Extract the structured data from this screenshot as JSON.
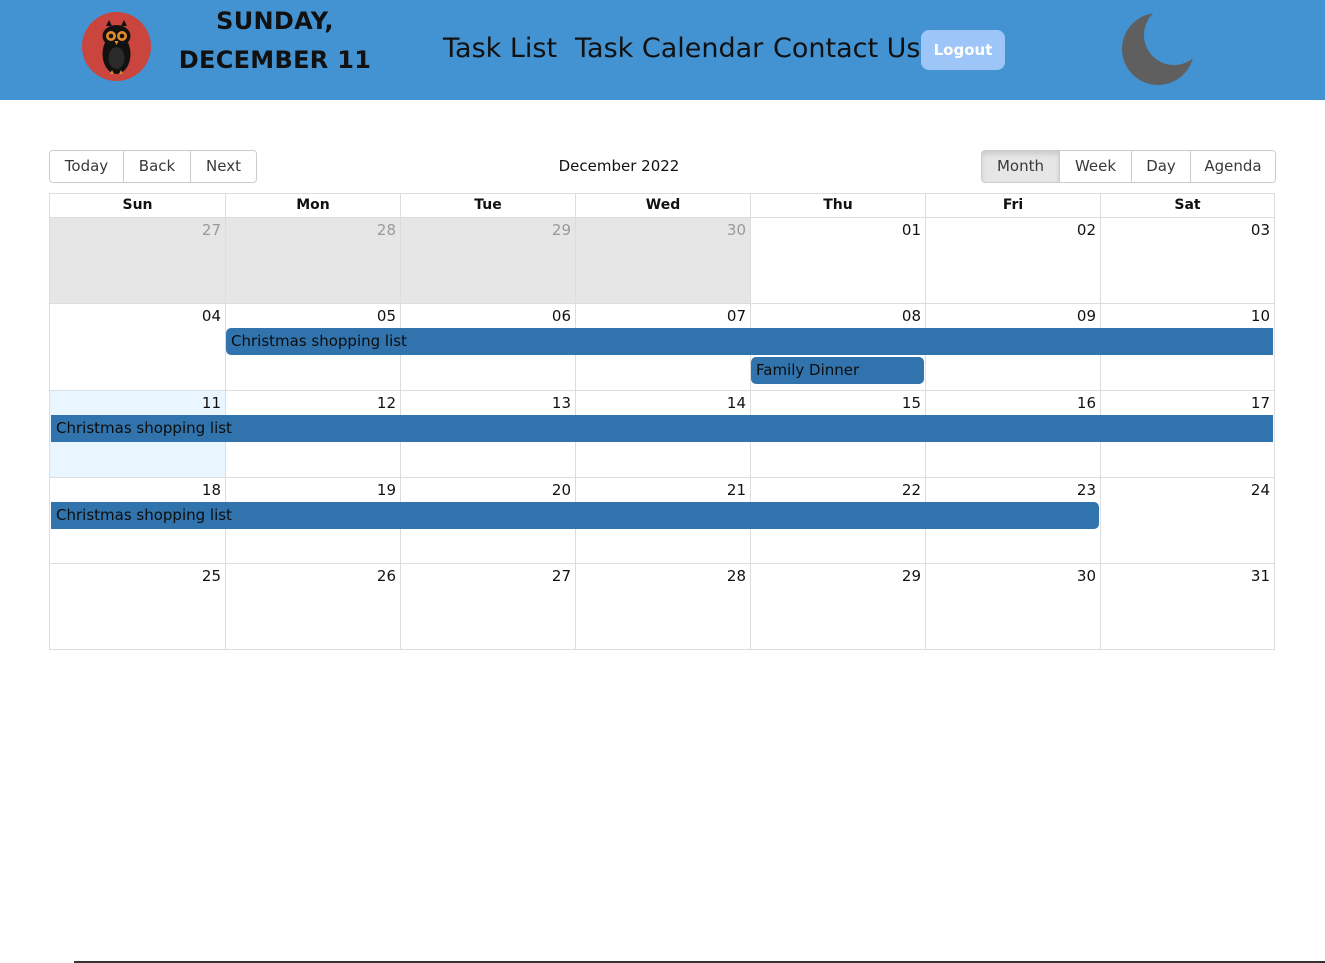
{
  "header": {
    "date_line1": "SUNDAY,",
    "date_line2": "DECEMBER 11",
    "nav": [
      "Task List",
      "Task Calendar",
      "Contact Us"
    ],
    "logout_label": "Logout",
    "logo_icon": "owl-logo-icon",
    "theme_icon": "moon-icon",
    "colors": {
      "header_bg": "#4393d3",
      "logout_bg": "#9ec5f7",
      "moon": "#5f5f5f",
      "logo_bg": "#c9453e"
    }
  },
  "toolbar": {
    "nav_buttons": [
      "Today",
      "Back",
      "Next"
    ],
    "label": "December 2022",
    "views": [
      "Month",
      "Week",
      "Day",
      "Agenda"
    ],
    "active_view": "Month"
  },
  "calendar": {
    "weekdays": [
      "Sun",
      "Mon",
      "Tue",
      "Wed",
      "Thu",
      "Fri",
      "Sat"
    ],
    "weeks": [
      {
        "days": [
          "27",
          "28",
          "29",
          "30",
          "01",
          "02",
          "03"
        ],
        "off": [
          true,
          true,
          true,
          true,
          false,
          false,
          false
        ]
      },
      {
        "days": [
          "04",
          "05",
          "06",
          "07",
          "08",
          "09",
          "10"
        ],
        "off": [
          false,
          false,
          false,
          false,
          false,
          false,
          false
        ]
      },
      {
        "days": [
          "11",
          "12",
          "13",
          "14",
          "15",
          "16",
          "17"
        ],
        "off": [
          false,
          false,
          false,
          false,
          false,
          false,
          false
        ]
      },
      {
        "days": [
          "18",
          "19",
          "20",
          "21",
          "22",
          "23",
          "24"
        ],
        "off": [
          false,
          false,
          false,
          false,
          false,
          false,
          false
        ]
      },
      {
        "days": [
          "25",
          "26",
          "27",
          "28",
          "29",
          "30",
          "31"
        ],
        "off": [
          false,
          false,
          false,
          false,
          false,
          false,
          false
        ]
      }
    ],
    "today_label": "11",
    "events": [
      {
        "title": "Christmas shopping list",
        "start_date": "2022-12-05",
        "end_date": "2022-12-23"
      },
      {
        "title": "Family Dinner",
        "start_date": "2022-12-08",
        "end_date": "2022-12-08"
      }
    ],
    "colors": {
      "event": "#3174ad",
      "off_range": "#e6e6e6",
      "today": "#eaf6ff",
      "border": "#dddddd"
    }
  }
}
